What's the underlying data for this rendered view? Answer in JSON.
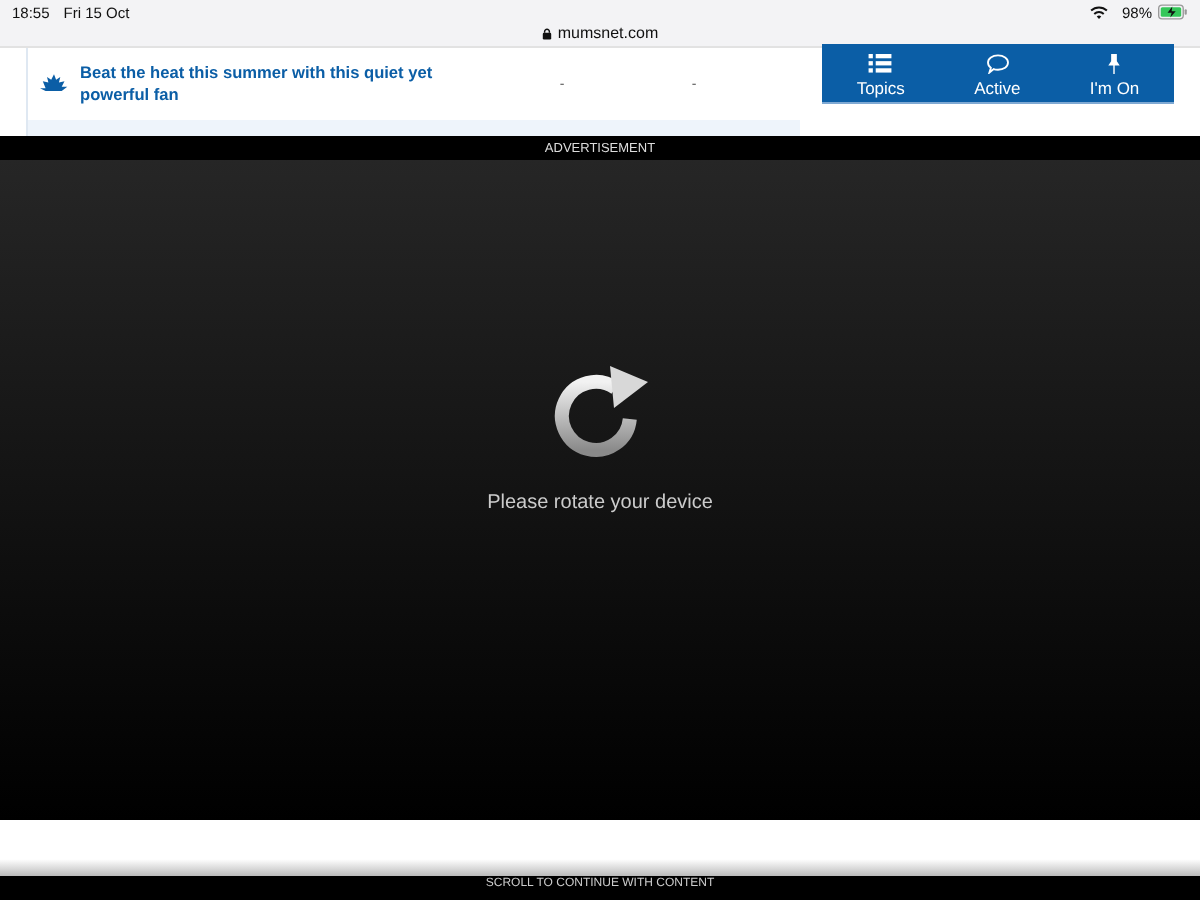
{
  "status_bar": {
    "time": "18:55",
    "date": "Fri 15 Oct",
    "battery": "98%",
    "charging": true
  },
  "address_bar": {
    "url": "mumsnet.com"
  },
  "threads": [
    {
      "title": "Beat the heat this summer with this quiet yet powerful fan",
      "column_2": "-",
      "column_3": "-"
    }
  ],
  "nav": [
    {
      "label": "Topics",
      "kind": "list"
    },
    {
      "label": "Active",
      "kind": "speech"
    },
    {
      "label": "I'm On",
      "kind": "pin"
    }
  ],
  "ad": {
    "label": "ADVERTISEMENT",
    "message": "Please rotate your device",
    "footer": "SCROLL TO CONTINUE WITH CONTENT"
  }
}
